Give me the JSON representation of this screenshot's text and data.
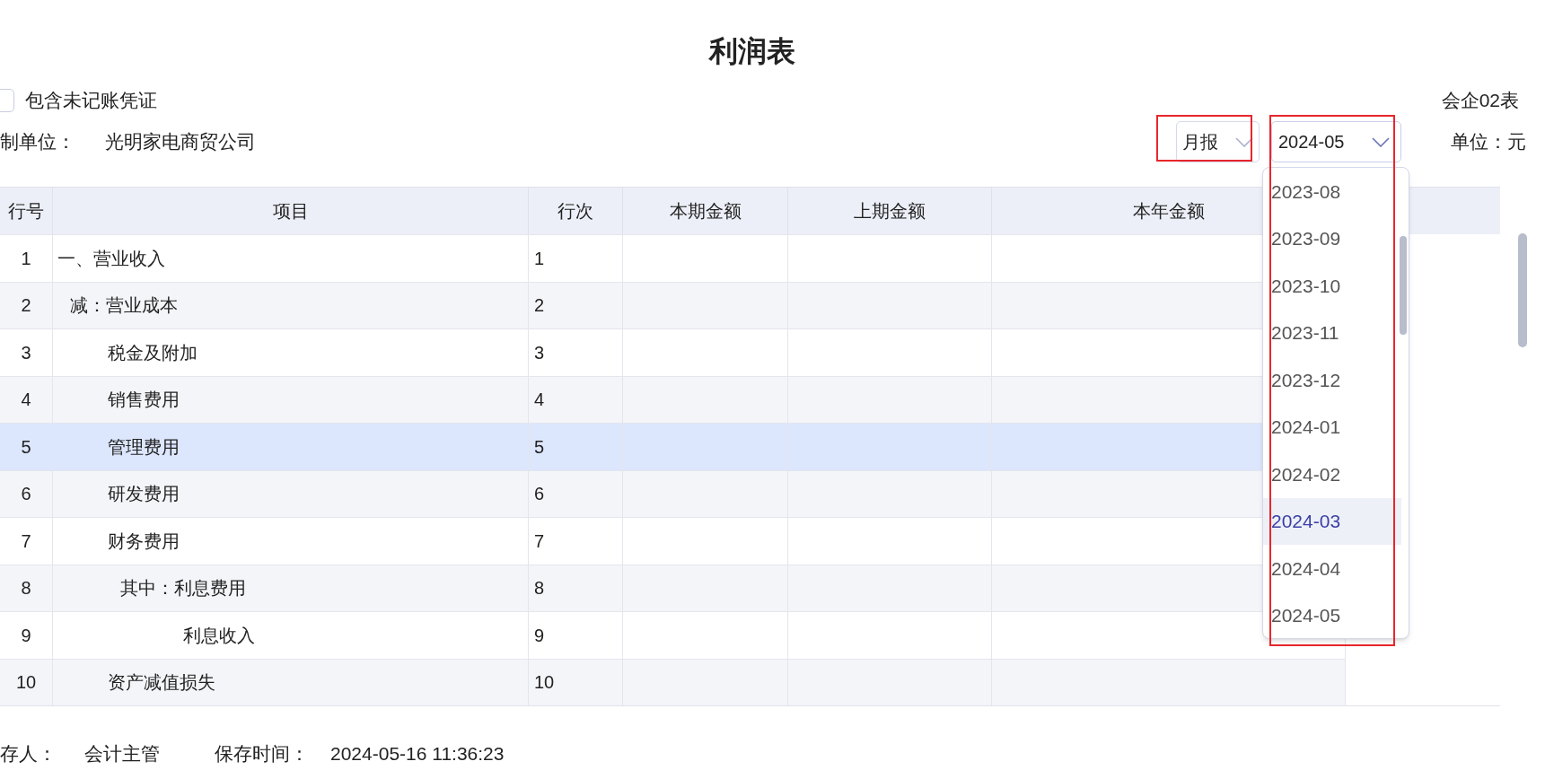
{
  "title": "利润表",
  "include_unposted": {
    "label": "包含未记账凭证",
    "checked": false
  },
  "form_code": "会企02表",
  "company_label": "制单位：",
  "company": "光明家电商贸公司",
  "period_type": {
    "value": "月报"
  },
  "period": {
    "value": "2024-05",
    "expanded": true,
    "options": [
      {
        "label": "2023-08",
        "highlighted": false
      },
      {
        "label": "2023-09",
        "highlighted": false
      },
      {
        "label": "2023-10",
        "highlighted": false
      },
      {
        "label": "2023-11",
        "highlighted": false
      },
      {
        "label": "2023-12",
        "highlighted": false
      },
      {
        "label": "2024-01",
        "highlighted": false
      },
      {
        "label": "2024-02",
        "highlighted": false
      },
      {
        "label": "2024-03",
        "highlighted": true
      },
      {
        "label": "2024-04",
        "highlighted": false
      },
      {
        "label": "2024-05",
        "highlighted": false
      }
    ]
  },
  "unit": "单位：元",
  "table": {
    "columns": [
      "行号",
      "项目",
      "行次",
      "本期金额",
      "上期金额",
      "本年金额"
    ],
    "rows": [
      {
        "no": "1",
        "item": "一、营业收入",
        "kind": "heading",
        "line": "1",
        "selected": false
      },
      {
        "no": "2",
        "item": "减：营业成本",
        "kind": "minus",
        "line": "2",
        "selected": false
      },
      {
        "no": "3",
        "item": "税金及附加",
        "kind": "item",
        "line": "3",
        "selected": false
      },
      {
        "no": "4",
        "item": "销售费用",
        "kind": "item",
        "line": "4",
        "selected": false
      },
      {
        "no": "5",
        "item": "管理费用",
        "kind": "item",
        "line": "5",
        "selected": true
      },
      {
        "no": "6",
        "item": "研发费用",
        "kind": "item",
        "line": "6",
        "selected": false
      },
      {
        "no": "7",
        "item": "财务费用",
        "kind": "item",
        "line": "7",
        "selected": false
      },
      {
        "no": "8",
        "item": "其中：利息费用",
        "kind": "detail",
        "line": "8",
        "selected": false
      },
      {
        "no": "9",
        "item": "利息收入",
        "kind": "detail_item",
        "line": "9",
        "selected": false
      },
      {
        "no": "10",
        "item": "资产减值损失",
        "kind": "item",
        "line": "10",
        "selected": false
      }
    ]
  },
  "footer": {
    "saver_label": "存人：",
    "saver": "会计主管",
    "time_label": "保存时间：",
    "time": "2024-05-16 11:36:23"
  }
}
